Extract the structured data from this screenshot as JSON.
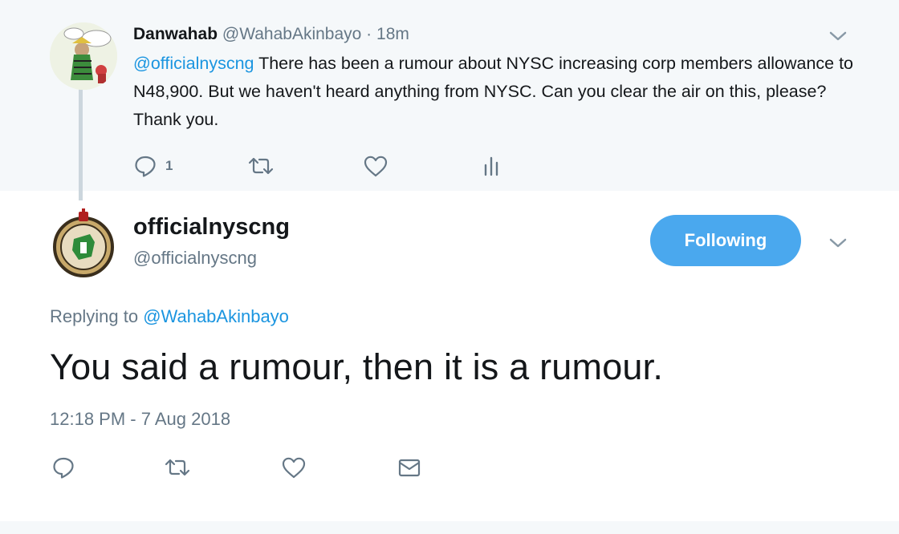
{
  "parent_tweet": {
    "display_name": "Danwahab",
    "handle": "@WahabAkinbayo",
    "separator": " · ",
    "time_ago": "18m",
    "mention": "@officialnyscng",
    "text": " There has been a rumour about NYSC increasing corp members allowance to N48,900. But we haven't heard anything from NYSC. Can you clear the air on this, please? Thank you.",
    "reply_count": "1",
    "icons": [
      "reply-icon",
      "retweet-icon",
      "like-icon",
      "analytics-icon",
      "chevron-down-icon"
    ]
  },
  "reply_tweet": {
    "display_name": "officialnyscng",
    "handle": "@officialnyscng",
    "follow_label": "Following",
    "replying_prefix": "Replying to ",
    "replying_to": "@WahabAkinbayo",
    "text": "You said a rumour, then it is a rumour.",
    "timestamp": "12:18 PM - 7 Aug 2018",
    "icons": [
      "reply-icon",
      "retweet-icon",
      "like-icon",
      "message-icon",
      "chevron-down-icon"
    ]
  },
  "colors": {
    "link": "#1b95e0",
    "follow_button": "#4aa8ee",
    "secondary_text": "#657786",
    "parent_background": "#f5f8fa"
  }
}
